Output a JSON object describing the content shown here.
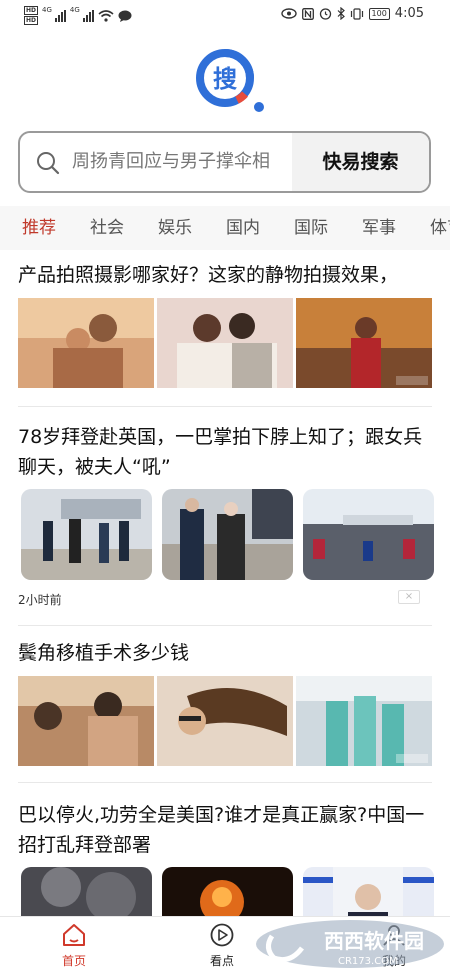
{
  "status_bar": {
    "sim1": "HD",
    "sim2": "HD",
    "net1": "4G",
    "net2": "4G",
    "battery": "100",
    "time": "4:05"
  },
  "search": {
    "placeholder": "周扬青回应与男子撑伞相",
    "button_label": "快易搜索"
  },
  "tabs": [
    {
      "label": "推荐",
      "active": true
    },
    {
      "label": "社会"
    },
    {
      "label": "娱乐"
    },
    {
      "label": "国内"
    },
    {
      "label": "国际"
    },
    {
      "label": "军事"
    },
    {
      "label": "体育"
    }
  ],
  "feed": [
    {
      "title": "产品拍照摄影哪家好？这家的静物拍摄效果，"
    },
    {
      "title": "78岁拜登赴英国，一巴掌拍下脖上知了；跟女兵聊天，被夫人“吼”",
      "time": "2小时前",
      "close": "×"
    },
    {
      "title": "鬓角移植手术多少钱"
    },
    {
      "title": "巴以停火,功劳全是美国?谁才是真正赢家?中国一招打乱拜登部署"
    }
  ],
  "bottom_nav": [
    {
      "label": "首页",
      "icon": "home-icon",
      "active": true
    },
    {
      "label": "看点",
      "icon": "play-icon"
    },
    {
      "label": "我的",
      "icon": "user-icon"
    }
  ],
  "watermark": {
    "brand": "西西软件园",
    "domain": "CR173.COM"
  },
  "colors": {
    "accent": "#c0392b",
    "logo_blue": "#2f6fd8",
    "logo_red": "#e74c3c"
  }
}
